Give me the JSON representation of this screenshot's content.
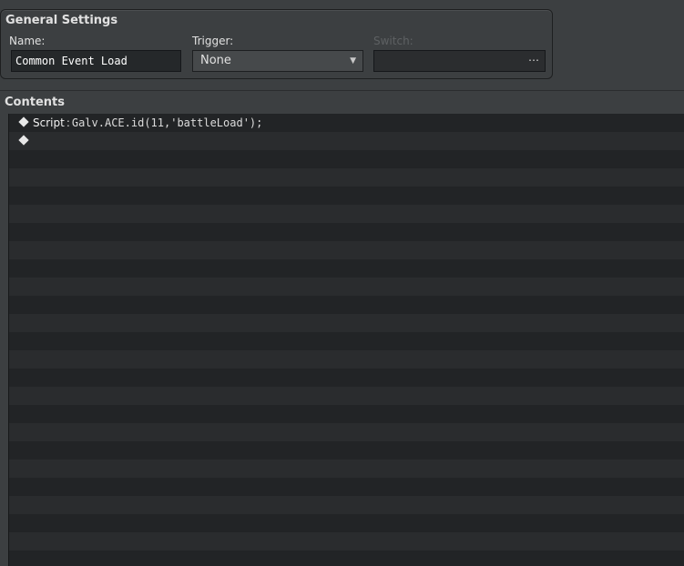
{
  "general": {
    "title": "General Settings",
    "name_label": "Name:",
    "name_value": "Common Event Load",
    "trigger_label": "Trigger:",
    "trigger_value": "None",
    "switch_label": "Switch:",
    "switch_button": "⋯"
  },
  "contents": {
    "title": "Contents",
    "rows": [
      {
        "command": "Script",
        "separator": ":",
        "text": "Galv.ACE.id(11,'battleLoad');"
      },
      {
        "command": "",
        "separator": "",
        "text": ""
      }
    ]
  },
  "colors": {
    "background": "#3c3f41",
    "list_row_dark": "#222426",
    "list_row_light": "#2a2c2e",
    "text": "#e1e1e1"
  }
}
